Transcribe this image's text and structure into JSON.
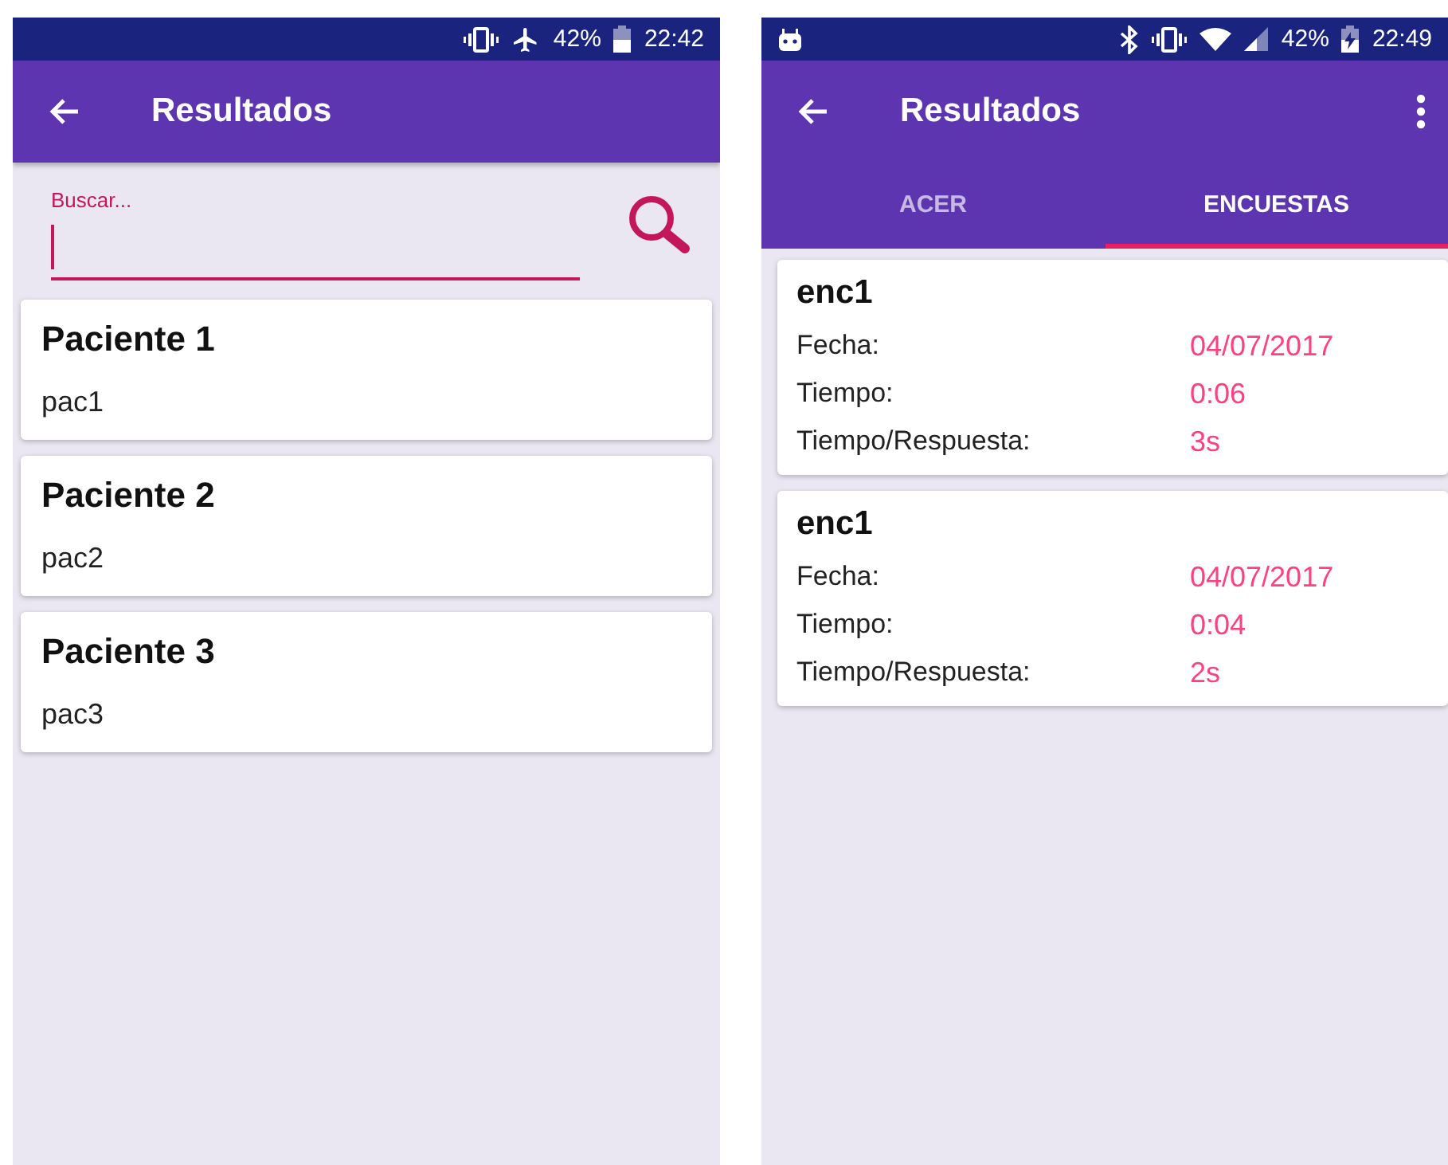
{
  "screens": [
    {
      "kind": "patients",
      "status_bar": {
        "battery": "42%",
        "time": "22:42"
      },
      "app_bar": {
        "title": "Resultados"
      },
      "search": {
        "placeholder": "Buscar..."
      },
      "patients": [
        {
          "name": "Paciente 1",
          "code": "pac1"
        },
        {
          "name": "Paciente 2",
          "code": "pac2"
        },
        {
          "name": "Paciente 3",
          "code": "pac3"
        }
      ]
    },
    {
      "kind": "surveys",
      "status_bar": {
        "battery": "42%",
        "time": "22:49"
      },
      "app_bar": {
        "title": "Resultados"
      },
      "tabs": [
        {
          "label": "ACER",
          "selected": false
        },
        {
          "label": "ENCUESTAS",
          "selected": true
        }
      ],
      "surveys": [
        {
          "title": "enc1",
          "fields": [
            {
              "label": "Fecha:",
              "value": "04/07/2017"
            },
            {
              "label": "Tiempo:",
              "value": "0:06"
            },
            {
              "label": "Tiempo/Respuesta:",
              "value": "3s"
            }
          ]
        },
        {
          "title": "enc1",
          "fields": [
            {
              "label": "Fecha:",
              "value": "04/07/2017"
            },
            {
              "label": "Tiempo:",
              "value": "0:04"
            },
            {
              "label": "Tiempo/Respuesta:",
              "value": "2s"
            }
          ]
        }
      ]
    }
  ]
}
